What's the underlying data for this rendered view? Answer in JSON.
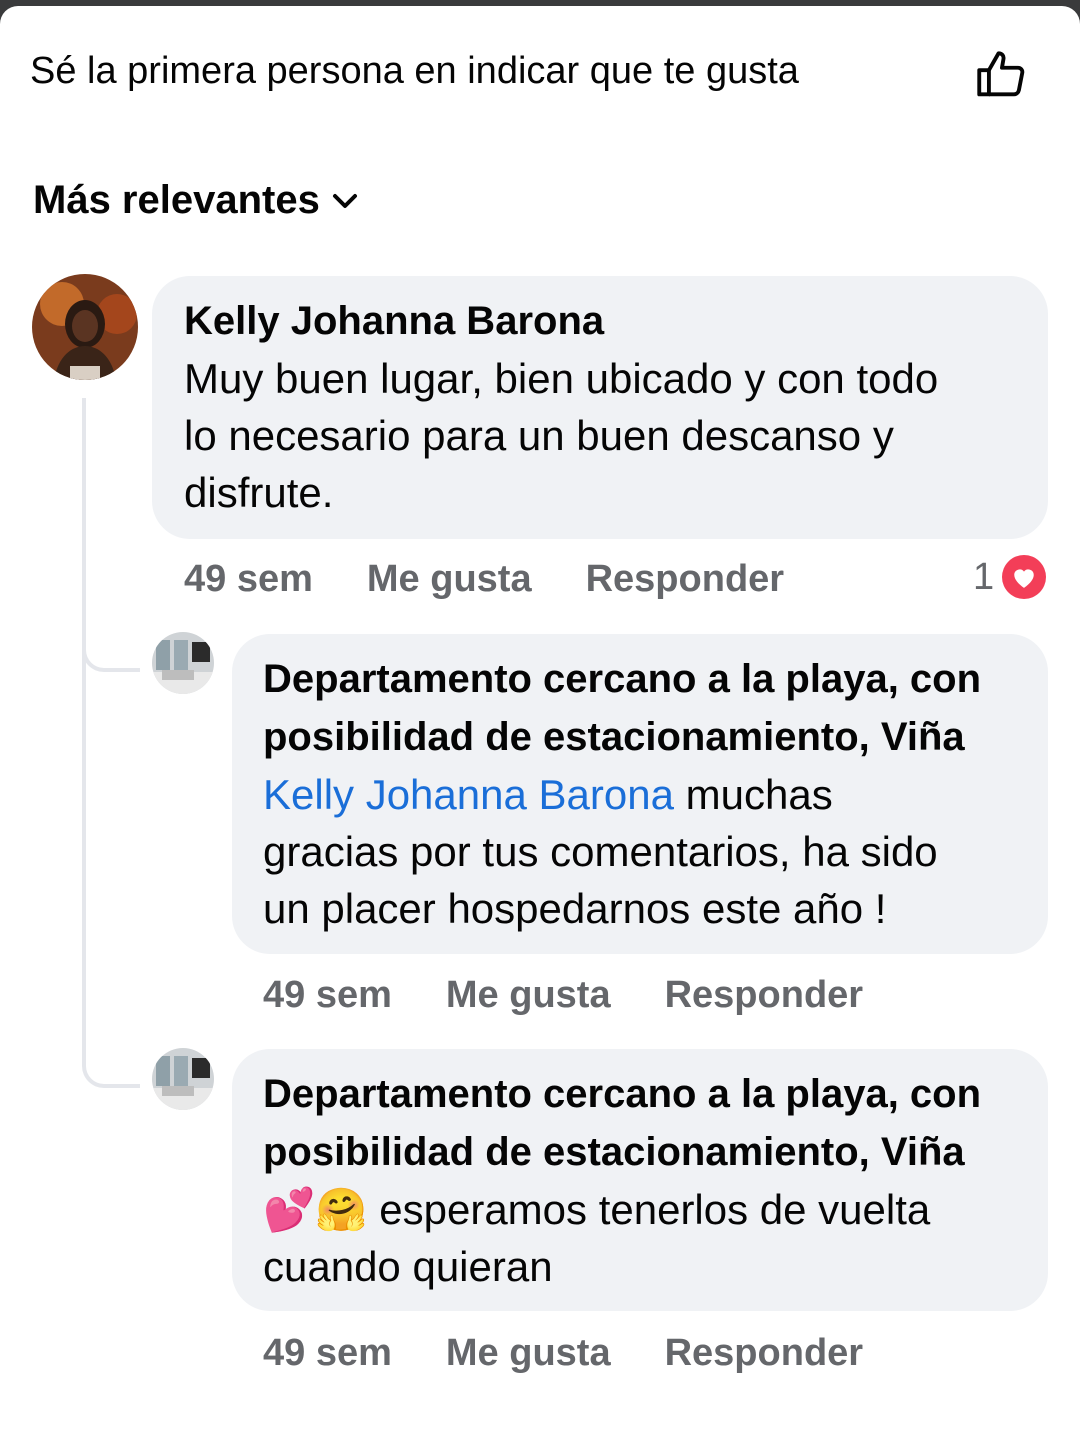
{
  "header": {
    "likes_prompt": "Sé la primera persona en indicar que te gusta",
    "like_icon": "thumbs-up-icon"
  },
  "sort": {
    "label": "Más relevantes",
    "icon": "chevron-down-icon"
  },
  "comments": [
    {
      "author": "Kelly Johanna Barona",
      "line1": "Muy buen lugar, bien ubicado y con todo",
      "line2": "lo necesario para un buen descanso y",
      "line3": "disfrute.",
      "time": "49 sem",
      "like_label": "Me gusta",
      "reply_label": "Responder",
      "reaction_count": "1",
      "reaction_icon": "heart-reaction-icon"
    }
  ],
  "replies": [
    {
      "author_line1": "Departamento cercano a la playa, con",
      "author_line2": "posibilidad de estacionamiento, Viña",
      "mention": "Kelly Johanna Barona",
      "text_after_mention": " muchas",
      "line2": "gracias por tus comentarios, ha sido",
      "line3": "un placer hospedarnos este año !",
      "time": "49 sem",
      "like_label": "Me gusta",
      "reply_label": "Responder"
    },
    {
      "author_line1": "Departamento cercano a la playa, con",
      "author_line2": "posibilidad de estacionamiento, Viña",
      "emoji": "💕🤗",
      "text_line1": "esperamos tenerlos de vuelta",
      "text_line2": "cuando quieran",
      "time": "49 sem",
      "like_label": "Me gusta",
      "reply_label": "Responder"
    }
  ],
  "colors": {
    "bubble": "#f0f2f5",
    "mention": "#1a6ed8",
    "meta": "#65676b",
    "heart": "#f33e58"
  }
}
